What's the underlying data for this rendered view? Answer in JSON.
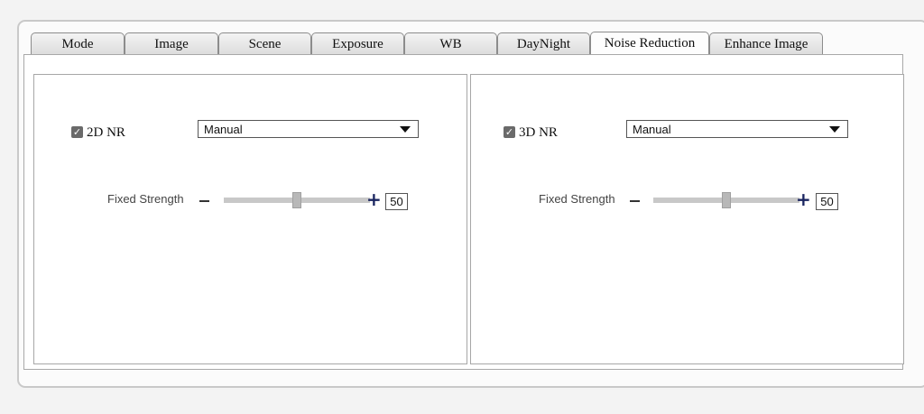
{
  "tabs": [
    {
      "label": "Mode",
      "active": false
    },
    {
      "label": "Image",
      "active": false
    },
    {
      "label": "Scene",
      "active": false
    },
    {
      "label": "Exposure",
      "active": false
    },
    {
      "label": "WB",
      "active": false
    },
    {
      "label": "DayNight",
      "active": false
    },
    {
      "label": "Noise Reduction",
      "active": true
    },
    {
      "label": "Enhance Image",
      "active": false
    }
  ],
  "nr2d": {
    "label": "2D NR",
    "checked": true,
    "mode": "Manual",
    "strength_label": "Fixed Strength",
    "strength_value": "50",
    "strength_min": 0,
    "strength_max": 100
  },
  "nr3d": {
    "label": "3D NR",
    "checked": true,
    "mode": "Manual",
    "strength_label": "Fixed Strength",
    "strength_value": "50",
    "strength_min": 0,
    "strength_max": 100
  },
  "icons": {
    "check": "check-icon",
    "dropdown": "triangle-down-icon",
    "minus": "minus-icon",
    "plus": "plus-icon"
  }
}
